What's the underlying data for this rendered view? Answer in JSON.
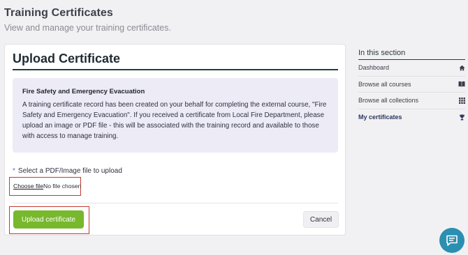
{
  "header": {
    "title": "Training Certificates",
    "subtitle": "View and manage your training certificates."
  },
  "card": {
    "title": "Upload Certificate",
    "info": {
      "heading": "Fire Safety and Emergency Evacuation",
      "text": "A training certificate record has been created on your behalf for completing the external course, \"Fire Safety and Emergency Evacuation\". If you received a certificate from Local Fire Department, please upload an image or PDF file - this will be associated with the training record and available to those with access to manage training."
    },
    "file_field": {
      "required_marker": "*",
      "label": "Select a PDF/Image file to upload",
      "choose_label": "Choose file",
      "status": "No file chosen"
    },
    "upload_label": "Upload certificate",
    "cancel_label": "Cancel"
  },
  "sidebar": {
    "heading": "In this section",
    "items": [
      {
        "label": "Dashboard",
        "icon": "home-icon"
      },
      {
        "label": "Browse all courses",
        "icon": "book-icon"
      },
      {
        "label": "Browse all collections",
        "icon": "grid-icon"
      },
      {
        "label": "My certificates",
        "icon": "trophy-icon",
        "active": true
      }
    ]
  },
  "colors": {
    "accent_green": "#77b82c",
    "heading_rule": "#1d3f3f",
    "info_bg": "#ecebf6",
    "highlight_box": "#c23a2f",
    "chat_button": "#2a8fb1"
  }
}
